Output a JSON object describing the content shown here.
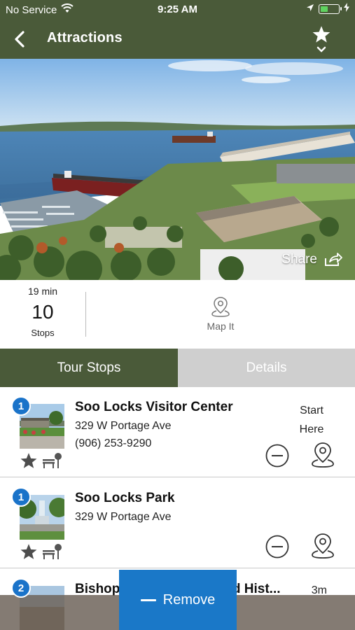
{
  "status_bar": {
    "carrier": "No Service",
    "time": "9:25 AM",
    "battery_level": 0.35
  },
  "nav": {
    "title": "Attractions",
    "back_icon": "chevron-left-icon",
    "favorite_icon": "star-icon",
    "expand_icon": "chevron-down-icon"
  },
  "hero": {
    "share_label": "Share"
  },
  "summary": {
    "duration": "19 min",
    "stop_count": "10",
    "stop_unit": "Stops",
    "map_label": "Map It"
  },
  "tabs": [
    {
      "label": "Tour Stops",
      "active": true
    },
    {
      "label": "Details",
      "active": false
    }
  ],
  "stops": [
    {
      "number": "1",
      "name": "Soo Locks Visitor Center",
      "address": "329 W Portage Ave",
      "phone": "(906) 253-9290",
      "start_label": "Start Here"
    },
    {
      "number": "1",
      "name": "Soo Locks Park",
      "address": "329 W Portage Ave",
      "phone": "",
      "start_label": ""
    },
    {
      "number": "2",
      "name": "Bishop Baraga House and Hist...",
      "address": "",
      "phone": "",
      "distance": "3m"
    }
  ],
  "remove_button": {
    "label": "Remove"
  },
  "colors": {
    "header_green": "#4a5a39",
    "badge_blue": "#1a73c9",
    "remove_blue": "#1a78c8",
    "tab_inactive": "#cfcfcf"
  }
}
